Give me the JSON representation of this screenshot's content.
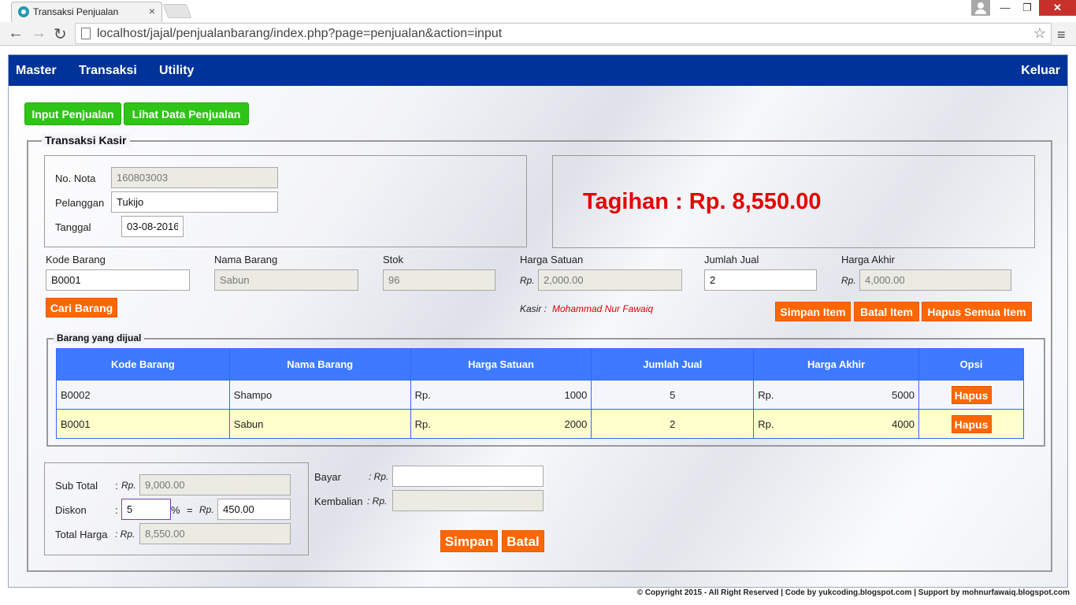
{
  "browser": {
    "tab_title": "Transaksi Penjualan",
    "tab_close": "×",
    "url": "localhost/jajal/penjualanbarang/index.php?page=penjualan&action=input",
    "win_min": "—",
    "win_max": "❐",
    "win_close": "✕",
    "back": "←",
    "forward": "→",
    "reload": "↻",
    "star": "☆",
    "menu": "≡"
  },
  "navbar": {
    "items": [
      "Master",
      "Transaksi",
      "Utility"
    ],
    "logout": "Keluar"
  },
  "tabs": {
    "input": "Input Penjualan",
    "view": "Lihat Data Penjualan"
  },
  "kasir": {
    "legend": "Transaksi Kasir",
    "no_nota_label": "No. Nota",
    "no_nota": "160803003",
    "pelanggan_label": "Pelanggan",
    "pelanggan": "Tukijo",
    "tanggal_label": "Tanggal",
    "tanggal": "03-08-2016",
    "tagihan": "Tagihan : Rp. 8,550.00"
  },
  "item_form": {
    "kode_label": "Kode Barang",
    "kode": "B0001",
    "nama_label": "Nama Barang",
    "nama": "Sabun",
    "stok_label": "Stok",
    "stok": "96",
    "harga_label": "Harga Satuan",
    "harga": "2,000.00",
    "jumlah_label": "Jumlah Jual",
    "jumlah": "2",
    "akhir_label": "Harga Akhir",
    "akhir": "4,000.00",
    "rp": "Rp.",
    "cari_btn": "Cari Barang",
    "kasir_label": "Kasir :",
    "kasir_name": "Mohammad Nur Fawaiq",
    "simpan_item": "Simpan Item",
    "batal_item": "Batal Item",
    "hapus_semua": "Hapus Semua Item"
  },
  "items_table": {
    "legend": "Barang yang dijual",
    "headers": [
      "Kode Barang",
      "Nama Barang",
      "Harga Satuan",
      "Jumlah Jual",
      "Harga Akhir",
      "Opsi"
    ],
    "rows": [
      {
        "kode": "B0002",
        "nama": "Shampo",
        "rp": "Rp.",
        "harga": "1000",
        "jumlah": "5",
        "rp2": "Rp.",
        "akhir": "5000",
        "opsi": "Hapus"
      },
      {
        "kode": "B0001",
        "nama": "Sabun",
        "rp": "Rp.",
        "harga": "2000",
        "jumlah": "2",
        "rp2": "Rp.",
        "akhir": "4000",
        "opsi": "Hapus"
      }
    ]
  },
  "totals": {
    "sub_total_label": "Sub Total",
    "sub_total": "9,000.00",
    "diskon_label": "Diskon",
    "diskon_pct": "5",
    "pct_sign": "%",
    "equals": "=",
    "diskon_value": "450.00",
    "total_label": "Total Harga",
    "total": "8,550.00",
    "colon": ":",
    "colon_rp": ": Rp.",
    "rp": "Rp.",
    "bayar_label": "Bayar",
    "bayar": "",
    "kembalian_label": "Kembalian",
    "kembalian": "",
    "simpan": "Simpan",
    "batal": "Batal"
  },
  "footer": "© Copyright 2015 - All Right Reserved | Code by yukcoding.blogspot.com | Support by mohnurfawaiq.blogspot.com"
}
